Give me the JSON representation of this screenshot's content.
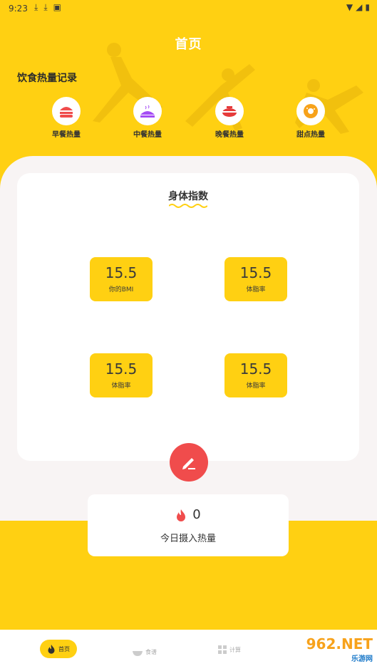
{
  "status": {
    "time": "9:23",
    "left_icons": [
      "download-icon",
      "download-icon",
      "app-icon"
    ],
    "right_icons": [
      "wifi-icon",
      "signal-icon",
      "battery-icon"
    ]
  },
  "header": {
    "title": "首页"
  },
  "section": {
    "label": "饮食热量记录"
  },
  "meals": [
    {
      "label": "早餐热量",
      "icon": "breakfast-icon",
      "color": "#f04c4c"
    },
    {
      "label": "中餐热量",
      "icon": "lunch-icon",
      "color": "#a54cf5"
    },
    {
      "label": "晚餐热量",
      "icon": "dinner-icon",
      "color": "#e63b3b"
    },
    {
      "label": "甜点热量",
      "icon": "dessert-icon",
      "color": "#f7a21b"
    }
  ],
  "body_index": {
    "title": "身体指数",
    "metrics": [
      {
        "value": "15.5",
        "label": "你的BMI"
      },
      {
        "value": "15.5",
        "label": "体脂率"
      },
      {
        "value": "15.5",
        "label": "体脂率"
      },
      {
        "value": "15.5",
        "label": "体脂率"
      }
    ]
  },
  "intake": {
    "value": "0",
    "label": "今日摄入热量"
  },
  "tabs": [
    {
      "label": "首页",
      "icon": "flame-icon",
      "active": true
    },
    {
      "label": "食谱",
      "icon": "bowl-icon",
      "active": false
    },
    {
      "label": "计算",
      "icon": "grid-icon",
      "active": false
    }
  ],
  "watermark": {
    "main": "962.NET",
    "sub": "乐游网"
  },
  "colors": {
    "accent": "#ffd012",
    "red": "#f04c4c"
  }
}
